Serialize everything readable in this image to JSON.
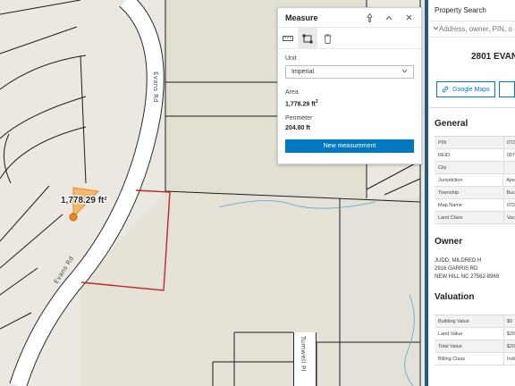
{
  "map": {
    "street_labels": [
      "Evans Rd",
      "Evans Rd",
      "Tumwell Pl"
    ],
    "measurement_label": "1,778.29 ft²"
  },
  "measure_widget": {
    "title": "Measure",
    "icons": [
      "pin-icon",
      "collapse-icon",
      "close-icon"
    ],
    "tools": [
      "distance-tool-icon",
      "area-tool-icon",
      "trash-icon"
    ],
    "unit_label": "Unit",
    "unit_selected": "Imperial",
    "area_label": "Area",
    "area_value": "1,778.29 ft",
    "area_unit_sup": "2",
    "perimeter_label": "Perimeter",
    "perimeter_value": "204.80 ft",
    "new_button": "New measurement"
  },
  "property_panel": {
    "title": "Property Search",
    "search_placeholder": "Address, owner, PIN, o",
    "address": "2801 EVAN",
    "links": [
      "Google Maps",
      ""
    ],
    "general_title": "General",
    "general_rows": [
      {
        "label": "PIN",
        "value": "072"
      },
      {
        "label": "REID",
        "value": "007"
      },
      {
        "label": "City",
        "value": ""
      },
      {
        "label": "Jurisdiction",
        "value": "Apo"
      },
      {
        "label": "Township",
        "value": "Buc"
      },
      {
        "label": "Map Name",
        "value": "072"
      },
      {
        "label": "Land Class",
        "value": "Vac"
      }
    ],
    "owner_title": "Owner",
    "owner_lines": [
      "JUDD, MILDRED H",
      "2916 GARRIS RD",
      "NEW HILL NC 27562-8969"
    ],
    "valuation_title": "Valuation",
    "valuation_rows": [
      {
        "label": "Building Value",
        "value": "$0"
      },
      {
        "label": "Land Value",
        "value": "$20"
      },
      {
        "label": "Total Value",
        "value": "$20"
      },
      {
        "label": "Billing Class",
        "value": "Indi"
      }
    ]
  },
  "colors": {
    "accent": "#0079c1",
    "parcel_highlight": "#c0282d",
    "measure_fill": "#f5a033",
    "panel_border": "#1f5a8a",
    "road_fill": "#ffffff",
    "parcel_fill": "#e6e3da"
  }
}
